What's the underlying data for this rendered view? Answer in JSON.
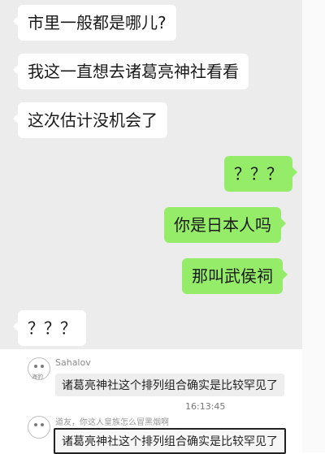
{
  "messages": [
    {
      "side": "left",
      "text": "市里一般都是哪儿?"
    },
    {
      "side": "left",
      "text": "我这一直想去诸葛亮神社看看"
    },
    {
      "side": "left",
      "text": "这次估计没机会了"
    },
    {
      "side": "right",
      "text": "？？？"
    },
    {
      "side": "right",
      "text": "你是日本人吗"
    },
    {
      "side": "right",
      "text": "那叫武侯祠"
    },
    {
      "side": "left",
      "text": "？？？"
    }
  ],
  "replies": {
    "user_name": "Sahalov",
    "avatar_tag": "海豹",
    "comment": "诸葛亮神社这个排列组合确实是比较罕见了",
    "time": "16:13:45",
    "quote_text": "道友，你这人皇族怎么冒黑烟啊",
    "comment2": "诸葛亮神社这个排列组合确实是比较罕见了"
  },
  "colors": {
    "chat_bg": "#ececec",
    "left_bubble": "#ffffff",
    "right_bubble": "#95ec69"
  }
}
